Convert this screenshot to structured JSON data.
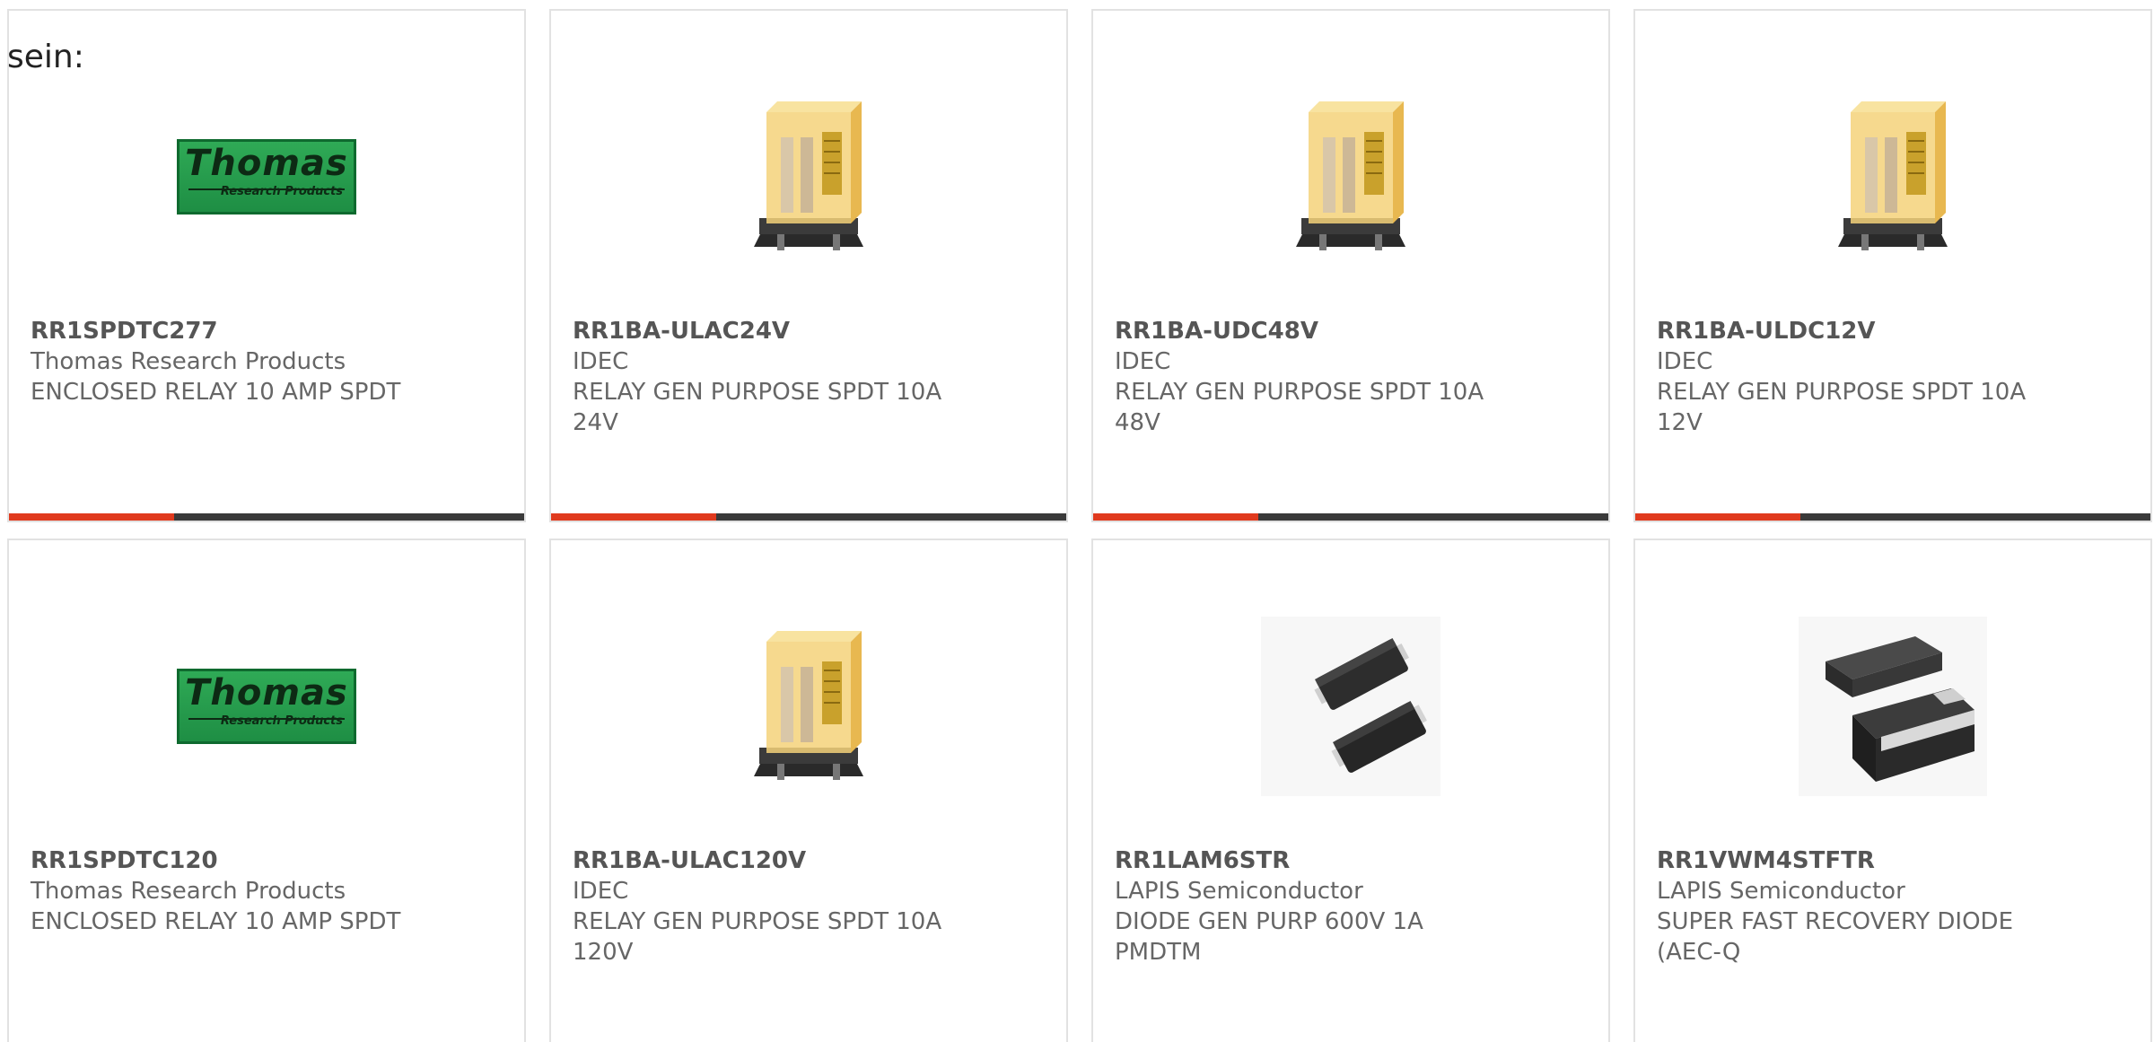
{
  "intro_text": "sein:",
  "progress_color": "#e03a1e",
  "track_color": "#3a3a3a",
  "cards": [
    {
      "part_number": "RR1SPDTC277",
      "manufacturer": "Thomas Research Products",
      "description": "ENCLOSED RELAY 10 AMP SPDT",
      "image": "thomas-logo",
      "logo_text": "Thomas",
      "logo_subtext": "Research Products",
      "progress": 0.32
    },
    {
      "part_number": "RR1BA-ULAC24V",
      "manufacturer": "IDEC",
      "description": "RELAY GEN PURPOSE SPDT 10A 24V",
      "image": "relay-photo",
      "progress": 0.32
    },
    {
      "part_number": "RR1BA-UDC48V",
      "manufacturer": "IDEC",
      "description": "RELAY GEN PURPOSE SPDT 10A 48V",
      "image": "relay-photo",
      "progress": 0.32
    },
    {
      "part_number": "RR1BA-ULDC12V",
      "manufacturer": "IDEC",
      "description": "RELAY GEN PURPOSE SPDT 10A 12V",
      "image": "relay-photo",
      "progress": 0.32
    },
    {
      "part_number": "RR1SPDTC120",
      "manufacturer": "Thomas Research Products",
      "description": "ENCLOSED RELAY 10 AMP SPDT",
      "image": "thomas-logo",
      "logo_text": "Thomas",
      "logo_subtext": "Research Products"
    },
    {
      "part_number": "RR1BA-ULAC120V",
      "manufacturer": "IDEC",
      "description": "RELAY GEN PURPOSE SPDT 10A 120V",
      "image": "relay-photo"
    },
    {
      "part_number": "RR1LAM6STR",
      "manufacturer": "LAPIS Semiconductor",
      "description": "DIODE GEN PURP 600V 1A PMDTM",
      "image": "diode-pair-photo"
    },
    {
      "part_number": "RR1VWM4STFTR",
      "manufacturer": "LAPIS Semiconductor",
      "description": "SUPER FAST RECOVERY DIODE (AEC-Q",
      "image": "diode-package-photo"
    }
  ]
}
